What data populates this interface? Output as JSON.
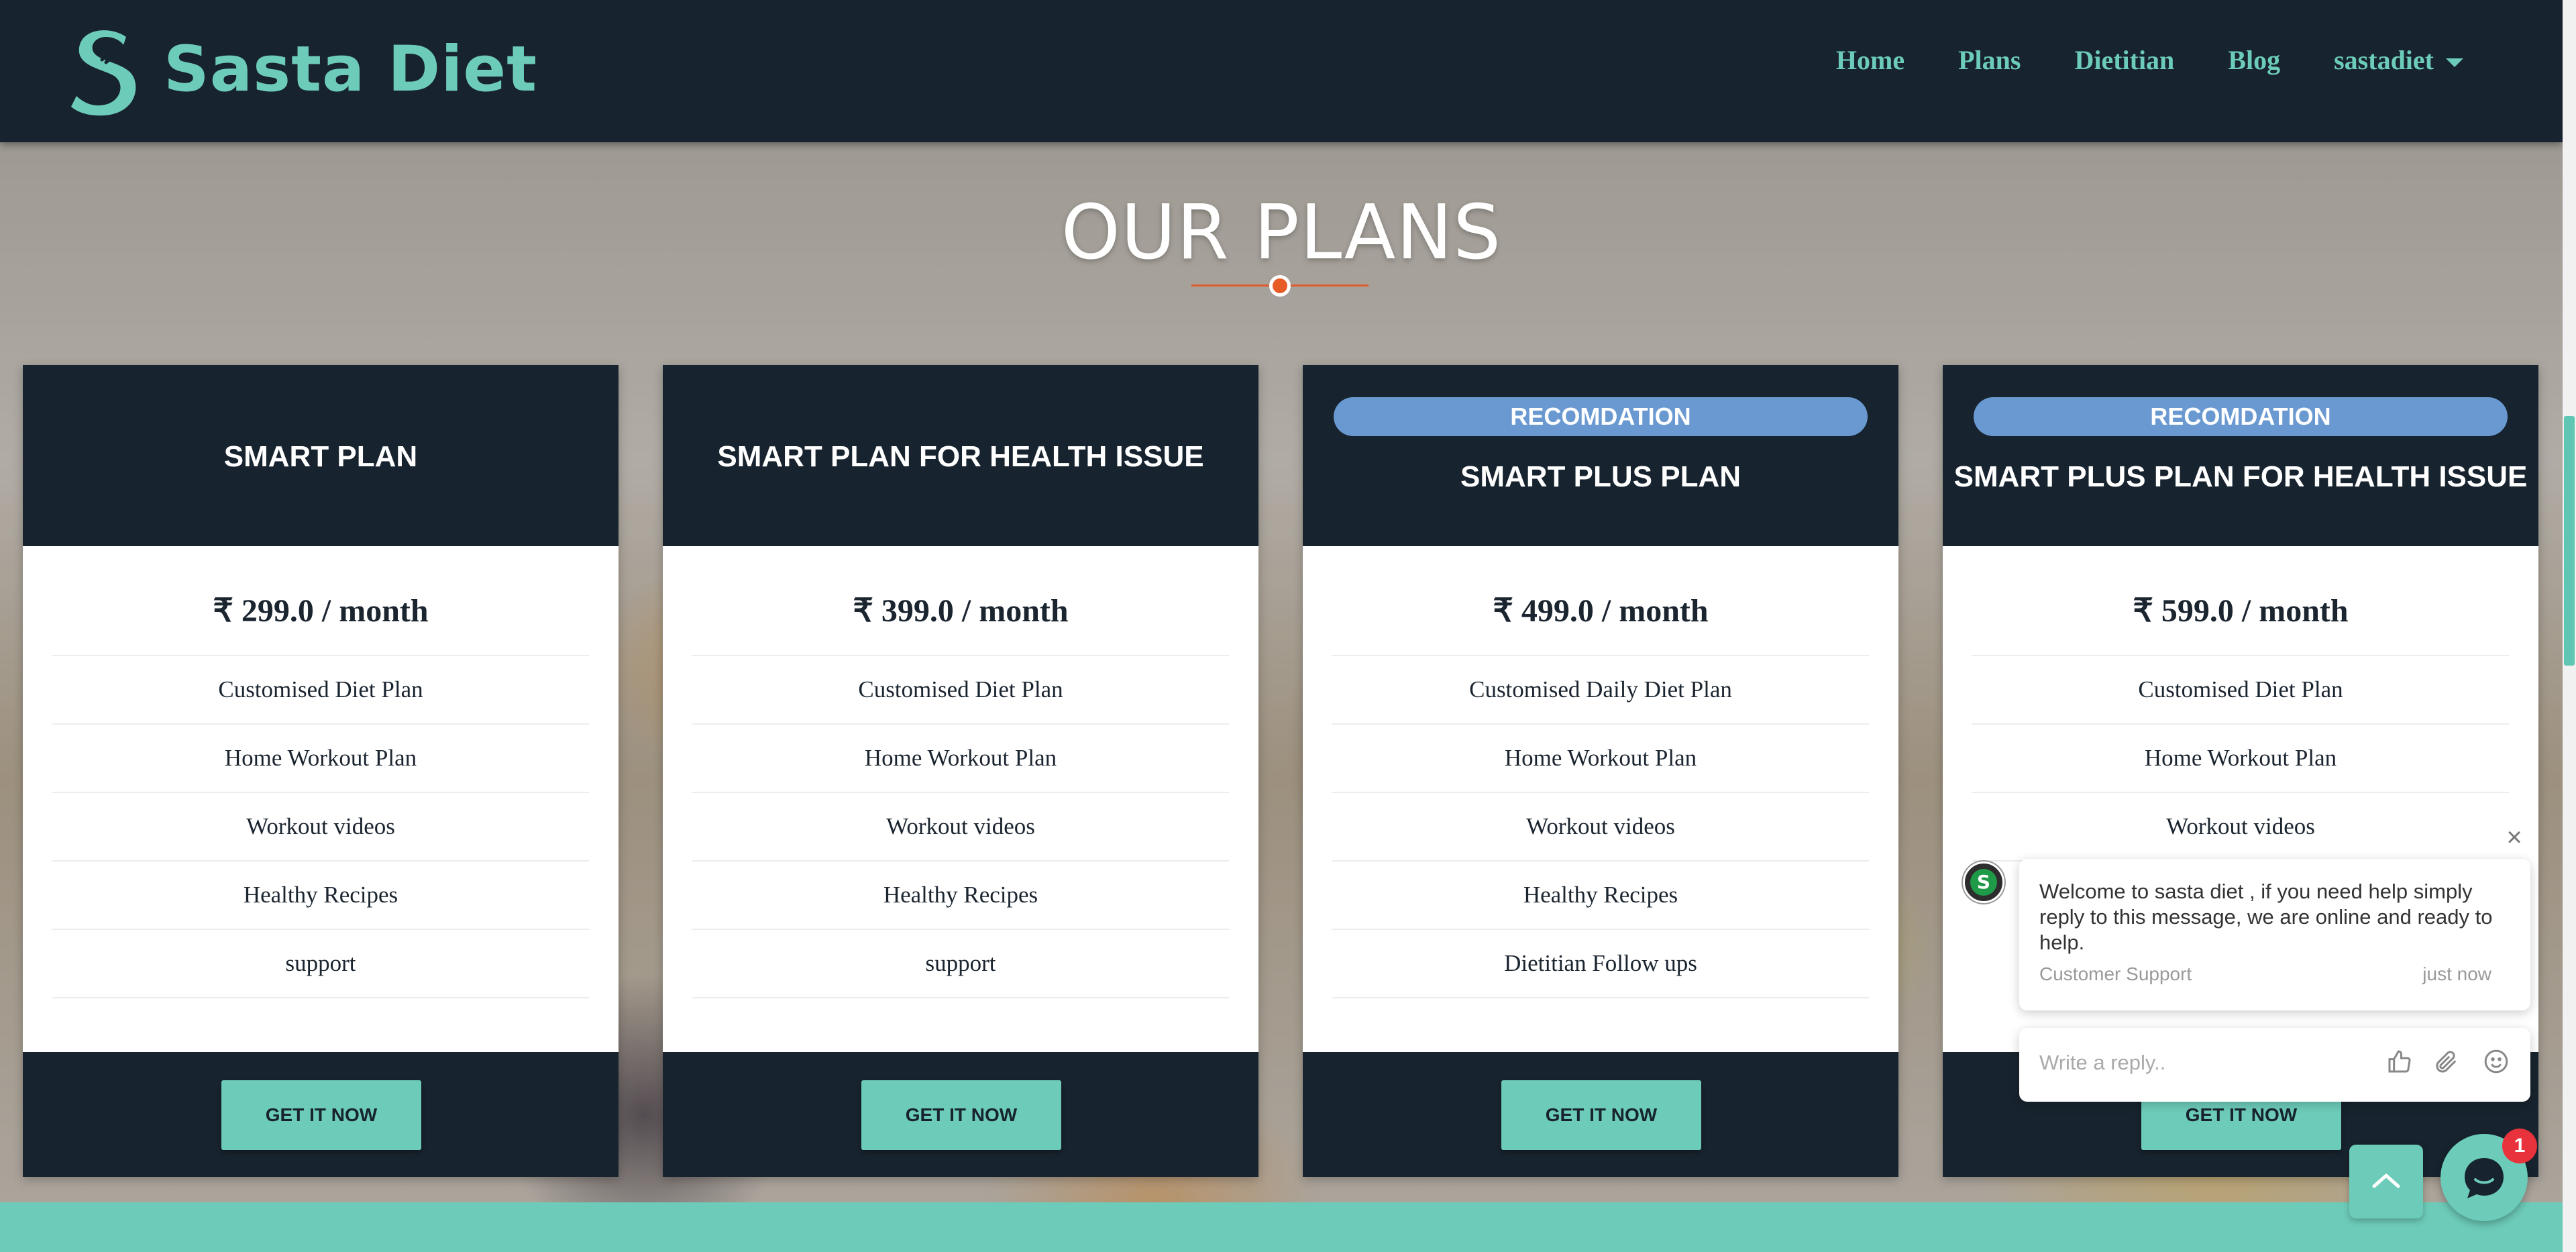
{
  "brand": {
    "name": "Sasta Diet"
  },
  "nav": {
    "items": [
      "Home",
      "Plans",
      "Dietitian",
      "Blog"
    ],
    "user": "sastadiet"
  },
  "page": {
    "heading": "OUR PLANS"
  },
  "plans": [
    {
      "badge": "",
      "title": "SMART PLAN",
      "price": "₹ 299.0 / month",
      "features": [
        "Customised Diet Plan",
        "Home Workout Plan",
        "Workout videos",
        "Healthy Recipes",
        "support"
      ],
      "button": "GET IT NOW"
    },
    {
      "badge": "",
      "title": "SMART PLAN FOR HEALTH ISSUE",
      "price": "₹ 399.0 / month",
      "features": [
        "Customised Diet Plan",
        "Home Workout Plan",
        "Workout videos",
        "Healthy Recipes",
        "support"
      ],
      "button": "GET IT NOW"
    },
    {
      "badge": "RECOMDATION",
      "title": "SMART PLUS PLAN",
      "price": "₹ 499.0 / month",
      "features": [
        "Customised Daily Diet Plan",
        "Home Workout Plan",
        "Workout videos",
        "Healthy Recipes",
        "Dietitian Follow ups"
      ],
      "button": "GET IT NOW"
    },
    {
      "badge": "RECOMDATION",
      "title": "SMART PLUS PLAN FOR HEALTH ISSUE",
      "price": "₹ 599.0 / month",
      "features": [
        "Customised Diet Plan",
        "Home Workout Plan",
        "Workout videos"
      ],
      "button": "GET IT NOW"
    }
  ],
  "chat": {
    "message": "Welcome to sasta diet , if you need help simply reply to this message, we are online and ready to help.",
    "sender": "Customer Support",
    "time": "just now",
    "input_placeholder": "Write a reply..",
    "unread_count": "1",
    "avatar_letter": "S"
  },
  "colors": {
    "navbar": "#17232e",
    "accent": "#6dccb9",
    "badge": "#6a99d1",
    "divider": "#e85b26"
  }
}
